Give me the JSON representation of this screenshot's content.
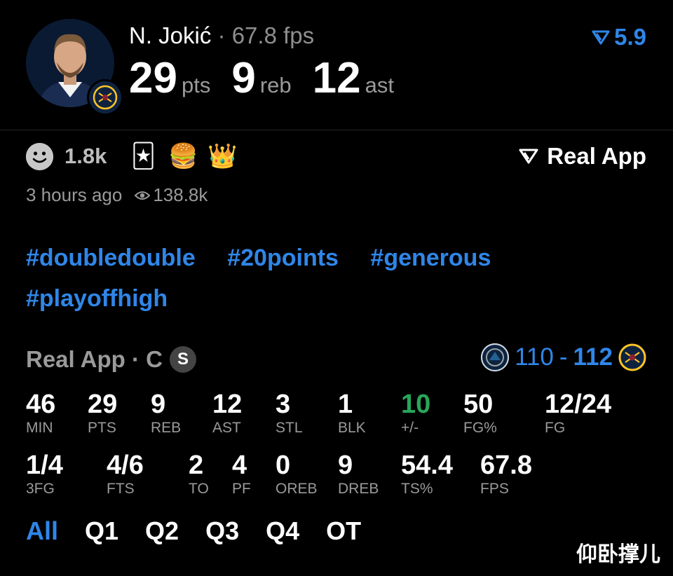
{
  "player": {
    "name": "N. Jokić",
    "separator": "·",
    "fps_label": "67.8 fps",
    "pts": "29",
    "pts_unit": "pts",
    "reb": "9",
    "reb_unit": "reb",
    "ast": "12",
    "ast_unit": "ast",
    "rating": "5.9",
    "team_badge_icon": "nuggets-logo-icon"
  },
  "reactions": {
    "count": "1.8k",
    "emojis": [
      "🃏",
      "🍔",
      "👑"
    ],
    "brand": "Real App",
    "time_ago": "3 hours ago",
    "views": "138.8k"
  },
  "hashtags": [
    "#doubledouble",
    "#20points",
    "#generous",
    "#playoffhigh"
  ],
  "game": {
    "source": "Real App · C",
    "badge": "S",
    "score_away": "110",
    "score_dash": "-",
    "score_home": "112"
  },
  "stats_row1": [
    {
      "v": "46",
      "l": "MIN"
    },
    {
      "v": "29",
      "l": "PTS"
    },
    {
      "v": "9",
      "l": "REB"
    },
    {
      "v": "12",
      "l": "AST"
    },
    {
      "v": "3",
      "l": "STL"
    },
    {
      "v": "1",
      "l": "BLK"
    },
    {
      "v": "10",
      "l": "+/-"
    },
    {
      "v": "50",
      "l": "FG%"
    },
    {
      "v": "12/24",
      "l": "FG"
    }
  ],
  "stats_row2": [
    {
      "v": "1/4",
      "l": "3FG"
    },
    {
      "v": "4/6",
      "l": "FTS"
    },
    {
      "v": "2",
      "l": "TO"
    },
    {
      "v": "4",
      "l": "PF"
    },
    {
      "v": "0",
      "l": "OREB"
    },
    {
      "v": "9",
      "l": "DREB"
    },
    {
      "v": "54.4",
      "l": "TS%"
    },
    {
      "v": "67.8",
      "l": "FPS"
    }
  ],
  "tabs": [
    "All",
    "Q1",
    "Q2",
    "Q3",
    "Q4",
    "OT"
  ],
  "watermark": "仰卧撑儿",
  "colors": {
    "accent": "#2f86e8",
    "positive": "#27a65a",
    "muted": "#9a9a9a",
    "background": "#000000"
  }
}
